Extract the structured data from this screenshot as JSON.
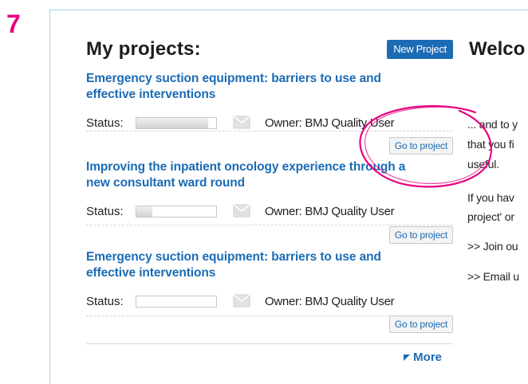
{
  "step": "7",
  "panel": {
    "title": "My projects:",
    "new_project_label": "New Project",
    "status_label": "Status:",
    "goto_label": "Go to project",
    "more_label": "More"
  },
  "projects": [
    {
      "title": "Emergency suction equipment: barriers to use and effective interventions",
      "owner": "Owner: BMJ Quality User",
      "progress": 0.9
    },
    {
      "title": "Improving the inpatient oncology experience through a new consultant ward round",
      "owner": "Owner: BMJ Quality User",
      "progress": 0.2
    },
    {
      "title": "Emergency suction equipment: barriers to use and effective interventions",
      "owner": "Owner: BMJ Quality User",
      "progress": 0.0
    }
  ],
  "side": {
    "title": "Welco",
    "lines": [
      "... and to y",
      "that you fi",
      "useful.",
      "If you hav",
      "project' or",
      ">> Join ou",
      ">> Email u"
    ]
  },
  "colors": {
    "accent": "#1b6bb5",
    "step": "#e6007e",
    "highlight": "#e6007e"
  }
}
